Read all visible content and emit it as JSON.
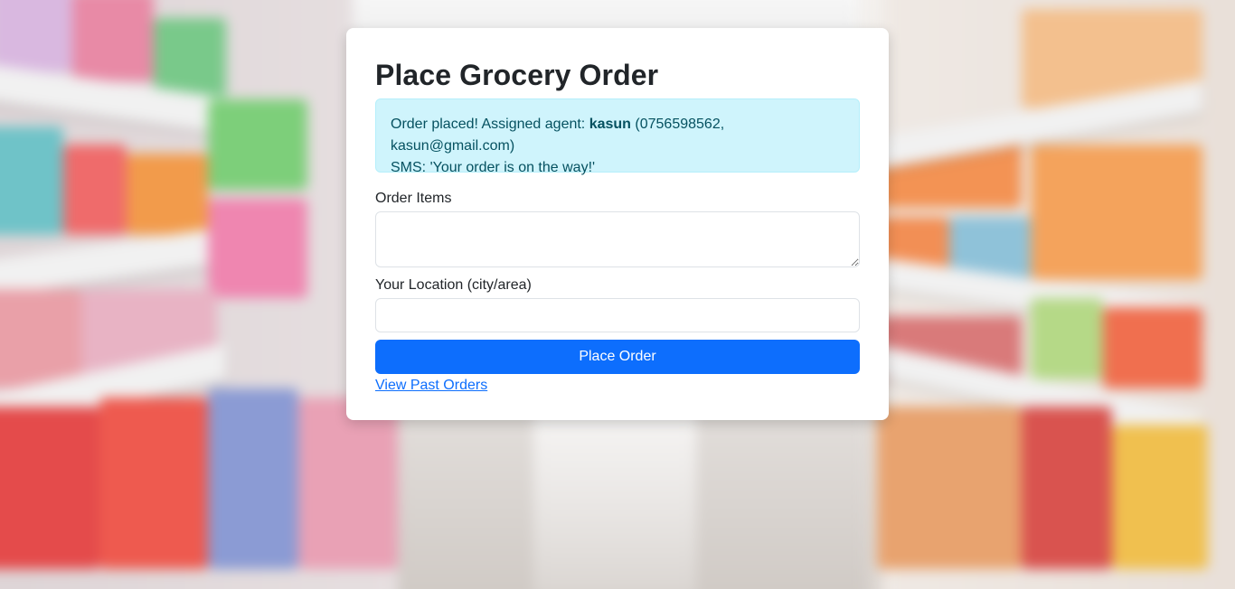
{
  "card": {
    "title": "Place Grocery Order"
  },
  "alert": {
    "prefix": "Order placed! Assigned agent: ",
    "agent_name": "kasun",
    "agent_contact": " (0756598562, kasun@gmail.com)",
    "sms": "SMS: 'Your order is on the way!'"
  },
  "form": {
    "items_label": "Order Items",
    "items_value": "",
    "location_label": "Your Location (city/area)",
    "location_value": "",
    "submit_label": "Place Order"
  },
  "links": {
    "past_orders": "View Past Orders"
  },
  "colors": {
    "primary": "#0d6efd",
    "alert_bg": "#cff4fc",
    "alert_text": "#055160"
  }
}
